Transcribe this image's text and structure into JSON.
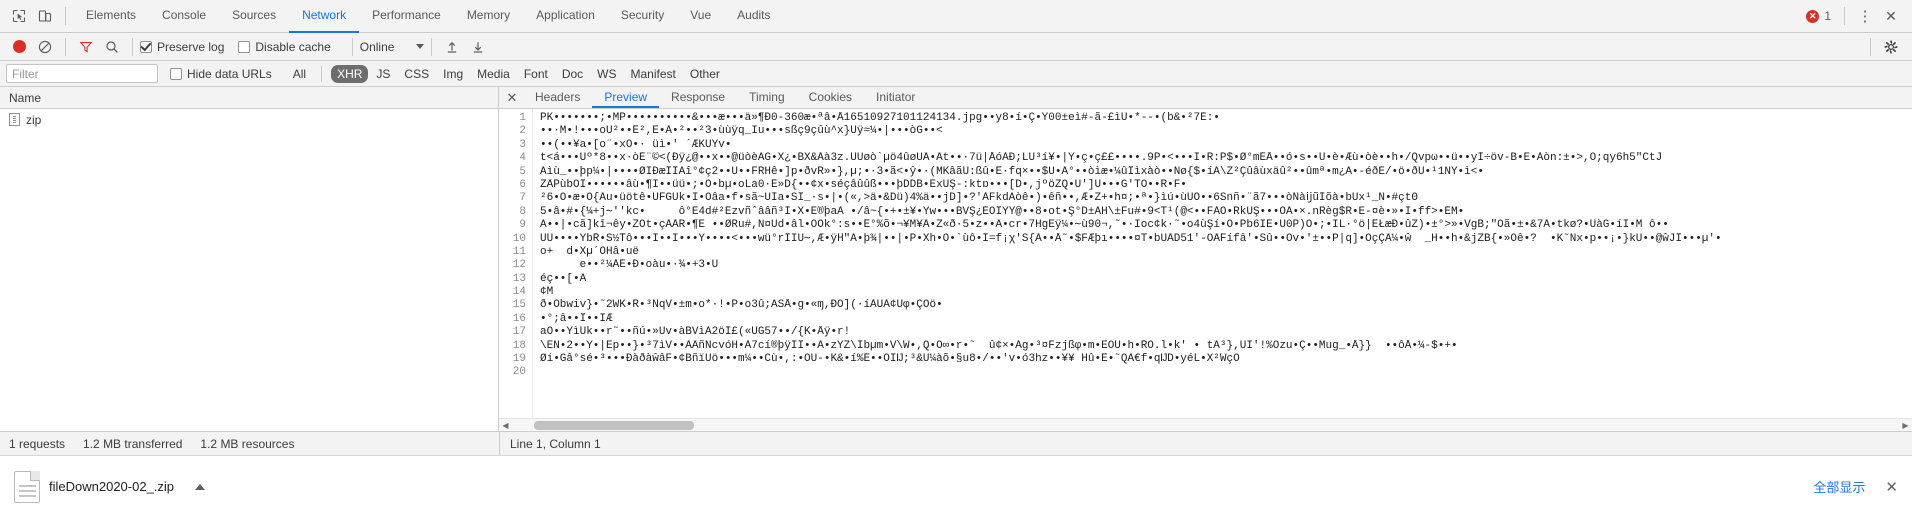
{
  "topbar": {
    "icons": [
      {
        "name": "inspect-element-icon",
        "glyph": "inspect"
      },
      {
        "name": "device-toolbar-icon",
        "glyph": "device"
      }
    ],
    "tabs": [
      {
        "label": "Elements",
        "active": false
      },
      {
        "label": "Console",
        "active": false
      },
      {
        "label": "Sources",
        "active": false
      },
      {
        "label": "Network",
        "active": true
      },
      {
        "label": "Performance",
        "active": false
      },
      {
        "label": "Memory",
        "active": false
      },
      {
        "label": "Application",
        "active": false
      },
      {
        "label": "Security",
        "active": false
      },
      {
        "label": "Vue",
        "active": false
      },
      {
        "label": "Audits",
        "active": false
      }
    ],
    "error_count": "1",
    "error_color": "#d93025",
    "more_label": "⋮",
    "close_label": "✕"
  },
  "controlbar": {
    "record_name": "record-button",
    "clear_name": "clear-button",
    "filter_name": "filter-toggle-icon",
    "search_name": "search-icon",
    "preserve_log_label": "Preserve log",
    "preserve_log_checked": true,
    "disable_cache_label": "Disable cache",
    "disable_cache_checked": false,
    "throttle_value": "Online",
    "import_name": "import-har-icon",
    "export_name": "export-har-icon",
    "settings_name": "gear-icon"
  },
  "filterbar": {
    "filter_placeholder": "Filter",
    "filter_value": "",
    "hide_data_urls_label": "Hide data URLs",
    "hide_data_urls_checked": false,
    "types": [
      {
        "label": "All",
        "active": false
      },
      {
        "label": "XHR",
        "active": true
      },
      {
        "label": "JS",
        "active": false
      },
      {
        "label": "CSS",
        "active": false
      },
      {
        "label": "Img",
        "active": false
      },
      {
        "label": "Media",
        "active": false
      },
      {
        "label": "Font",
        "active": false
      },
      {
        "label": "Doc",
        "active": false
      },
      {
        "label": "WS",
        "active": false
      },
      {
        "label": "Manifest",
        "active": false
      },
      {
        "label": "Other",
        "active": false
      }
    ]
  },
  "requests_panel": {
    "column_header": "Name",
    "rows": [
      {
        "name": "zip",
        "icon": "zip-file-icon"
      }
    ]
  },
  "detail_panel": {
    "close_label": "✕",
    "tabs": [
      {
        "label": "Headers",
        "active": false
      },
      {
        "label": "Preview",
        "active": true
      },
      {
        "label": "Response",
        "active": false
      },
      {
        "label": "Timing",
        "active": false
      },
      {
        "label": "Cookies",
        "active": false
      },
      {
        "label": "Initiator",
        "active": false
      }
    ],
    "line_numbers": [
      "1",
      "2",
      "3",
      "4",
      "5",
      "6",
      "7",
      "8",
      "9",
      "10",
      "11",
      "12",
      "13",
      "14",
      "15",
      "16",
      "17",
      "18",
      "19",
      "20"
    ],
    "lines": [
      "PK•••••••;•MP••••••••••&•••æ•••ä»¶Ð0-360æ•ªâ•Å16510927101124134.jpg••y8•í•Ç•Y00±eì#-ã-£ìÙ•*--•(b&•²7É:•",
      "••·M•!•••oÛ²••Ê²,E•Ã•²••²3•ùùÿq_Īu•••sßç9çûù^x}Ûÿ≈¼•|•••òG••<",
      "••(••¥a•[o¨•xÓ•· üì•' ´ÆKÛYv•",
      "t<á•••Ùº*8••x·òÈ¨©<(Ðÿ¿@••x••@üòèAG•X¿•BX&Âà3z.ÛÛøò`µö4ûøÜÃ•Ât••·7ü|ÅóÁÐ;LÛ³í¥•|Ý•ç•ç££••••.9P•<•••I•R:P$•Ø°mÉÅ••ó•s••Û•è•Æù•òè••h•/Qvpω••ü••yÍ÷öv-B•E•Àòn:±•>,Ô;qy6h5\"CtJ",
      "Ãìù_••þp¼•|••••ØIÐæÎÎÄî°¢ç2••Û••FRHê•]p•ðvR»•},µ;•·3•ã<•ŷ•·(MKâãÛ:ßû•Ê·fq×••$Û•Â°••òìæ•¼ûÎìxàò••Nø{$•íÂ\\Z²Çûâùxäû²••ûmª•m¿Ä•-éðÉ/•ö•ðÜ•¹1NY•ì<•",
      "ZÂPùbÔÎ••••••âù•¶I••üü•;•Õ•bµ•oLa0·Ê»D{••¢x•séçâûûß•••þDDB•ExÛŞ-:ktɒ•••[D•,jºöZQ•Ú']Ù•••G'TÔ••R•F•",
      "²6•Ó•æ•Ö{Ãu•üötê•ÛFGÜk•I•Ôâa•f•sã~ÛÍa•SÎ_·s•|•(«,>ä•&Dü)4%ä••jD]•?'ÁFkdAòê•)•êñ••,Æ•Z+•h¤;•ª•}ìú•ùÛÕ••6Snñ•¨ã7•••òÑàĳũÍõà•bÜx¹_Ñ•#çtΘ",
      "5•â•#•{¼+j∼''kc•     ô°E4d#²Ezvñˆââñ³Í•X•E®þaÃ •/â~{•+•±¥•Yw•••BVŞ¿ÉÔÎÝŶ@••8•ot•Ş°D±ÀH\\±Fu#•9<T¹(@<••FÀÔ•RkUŞ•••ÔÁ•×.nRèg$R•Ë-¤è•»•I•ff>•ÉM•",
      "Ä••|•cã]kī¬êy•ZÔt•çÂÂR•¶Ë¯••ØRu#,N¤Ud•âl•OÔk°:s••Ê°%õ•¬¥M¥Â•Z«ð·5•z••Â•cr•7HgEÿ¼•∼ù90¬,˜•·Ioc¢k·˜•o4ùŞí•Ô•Pb6IE•Û0P)Ò•;•IL·°ö|ÊŁæÐ•ûZ)•±°>»•VɡB;\"Òã•±•&7Ã•tkø?•ÛàǦ•íĪ•M ô••",
      "ÛÚ••••YbŘ•S½Ťô•••Ï••I•••Y••••<•••wü°rÎĪÛ∼,Æ•ÿĤ\"Â•þ¾|••|•P•Xh•Ó•`ùô•Î=f¡χ'S{Â••Å˜•$FÆþı••••¤T•bÛÂD51'-ÔÂFífâ'•Sû••Ov•'±••P|q]•ÓçÇÂ¼•ŵ  _H••h•&jZB{•»Ôê•?  •K˜Ñx•p••¡•}kÜ••@ŵJÎ•••µ'•",
      "o+  d•Xµ´ÔΗâ•uë",
      "      e••²¼ÁÉ•Ð•oàu•·¾•+3•Ù",
      "éç••[•Ä",
      "¢M",
      "ð•Ôbwiv}•˜2WK•R•³ÑqV•±m•o*·!•P•o3û;ASÅ•g•«ɱ,ÐÔ](·íÀÛÄ¢Ûφ•ÇÓö•",
      "•°;â••Î••ÎÆ",
      "aÔ••ŸìÜk••r˜••ñú•»Ùv•àBVìÃ2öÍ£(«ÜĠ57••/{K•Åÿ•r!",
      "\\ËÑ•2••Ÿ•|Ep••}•³7ìV••ÃÂñNcvóH•Ã7cí®þÿÍÎ••Â•zŸZ\\Íbµm•V\\Ŵ•,Q•Ô∞•r•˜  û¢×•Ág•³¤Fzjßφ•m•EÔÛ•h•ŘÔ.l•k' • tÂ³},UI'!%Ozu•Ç••Mug_•Å}}  ••ôÅ•¼-$•+•",
      "Øí•Gâ°sé•³•••ÐàðàŵâF•¢BñïÛö•••m¼••Cù•,:•ÔÛ-•K&•í%É••ÔÏĲ;³&Ú¼àõ•§u8•/••'v•ó3hz••¥¥ Hû•Ê•˜QÃ€f•qĲD•yéL•X²ŴçÔ",
      ""
    ],
    "scrollbar_name": "horizontal-scrollbar"
  },
  "statusbar": {
    "requests": "1 requests",
    "transferred": "1.2 MB transferred",
    "resources": "1.2 MB resources",
    "cursor_position": "Line 1, Column 1"
  },
  "download_shelf": {
    "file_name": "fileDown2020-02_.zip",
    "menu_name": "download-item-menu",
    "show_all_label": "全部显示",
    "close_label": "✕"
  }
}
